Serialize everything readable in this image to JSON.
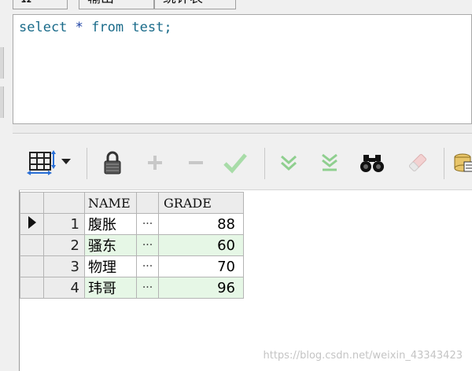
{
  "tabs": [
    {
      "label": "Ω",
      "partial": true
    },
    {
      "label": "输出"
    },
    {
      "label": "统计表"
    }
  ],
  "editor": {
    "sql": {
      "kw1": "select",
      "star": "*",
      "kw2": "from",
      "table": "test",
      "semi": ";"
    }
  },
  "toolbar": {
    "buttons": [
      {
        "name": "grid-view-dropdown",
        "icon": "grid-icon"
      },
      {
        "name": "lock-button",
        "icon": "lock-icon"
      },
      {
        "name": "add-record-button",
        "icon": "plus-icon"
      },
      {
        "name": "delete-record-button",
        "icon": "minus-icon"
      },
      {
        "name": "post-changes-button",
        "icon": "checkmark-icon"
      },
      {
        "name": "next-page-button",
        "icon": "double-chevron-down-icon"
      },
      {
        "name": "last-page-button",
        "icon": "double-chevron-down-bar-icon"
      },
      {
        "name": "find-button",
        "icon": "binoculars-icon"
      },
      {
        "name": "clear-button",
        "icon": "eraser-icon"
      },
      {
        "name": "export-button",
        "icon": "database-export-icon"
      }
    ]
  },
  "grid": {
    "columns": [
      "NAME",
      "GRADE"
    ],
    "rows": [
      {
        "num": "1",
        "name": "腹胀",
        "dots": "···",
        "grade": "88",
        "current": true
      },
      {
        "num": "2",
        "name": "骚东",
        "dots": "···",
        "grade": "60"
      },
      {
        "num": "3",
        "name": "物理",
        "dots": "···",
        "grade": "70"
      },
      {
        "num": "4",
        "name": "玮哥",
        "dots": "···",
        "grade": "96"
      }
    ]
  },
  "watermark": "https://blog.csdn.net/weixin_43343423",
  "colors": {
    "keyword": "#1a6b8a",
    "alt_row": "#e6f7e6",
    "check_green": "#8fd08f"
  }
}
